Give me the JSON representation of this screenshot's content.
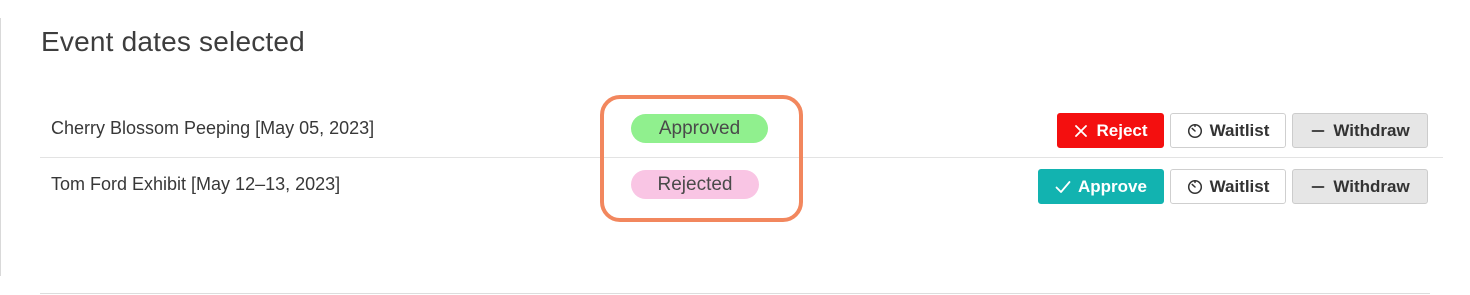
{
  "section": {
    "title": "Event dates selected"
  },
  "events": [
    {
      "name": "Cherry Blossom Peeping [May 05, 2023]",
      "status": "Approved",
      "actions": {
        "primary": "Reject",
        "waitlist": "Waitlist",
        "withdraw": "Withdraw"
      }
    },
    {
      "name": "Tom Ford Exhibit [May 12–13, 2023]",
      "status": "Rejected",
      "actions": {
        "primary": "Approve",
        "waitlist": "Waitlist",
        "withdraw": "Withdraw"
      }
    }
  ],
  "colors": {
    "approved_badge": "#90f08e",
    "rejected_badge": "#f9c5e4",
    "reject_button": "#f40f0f",
    "approve_button": "#12b3b0",
    "highlight": "#f2875e"
  },
  "icons": {
    "reject": "close-icon",
    "approve": "check-icon",
    "waitlist": "timer-icon",
    "withdraw": "minus-icon"
  }
}
